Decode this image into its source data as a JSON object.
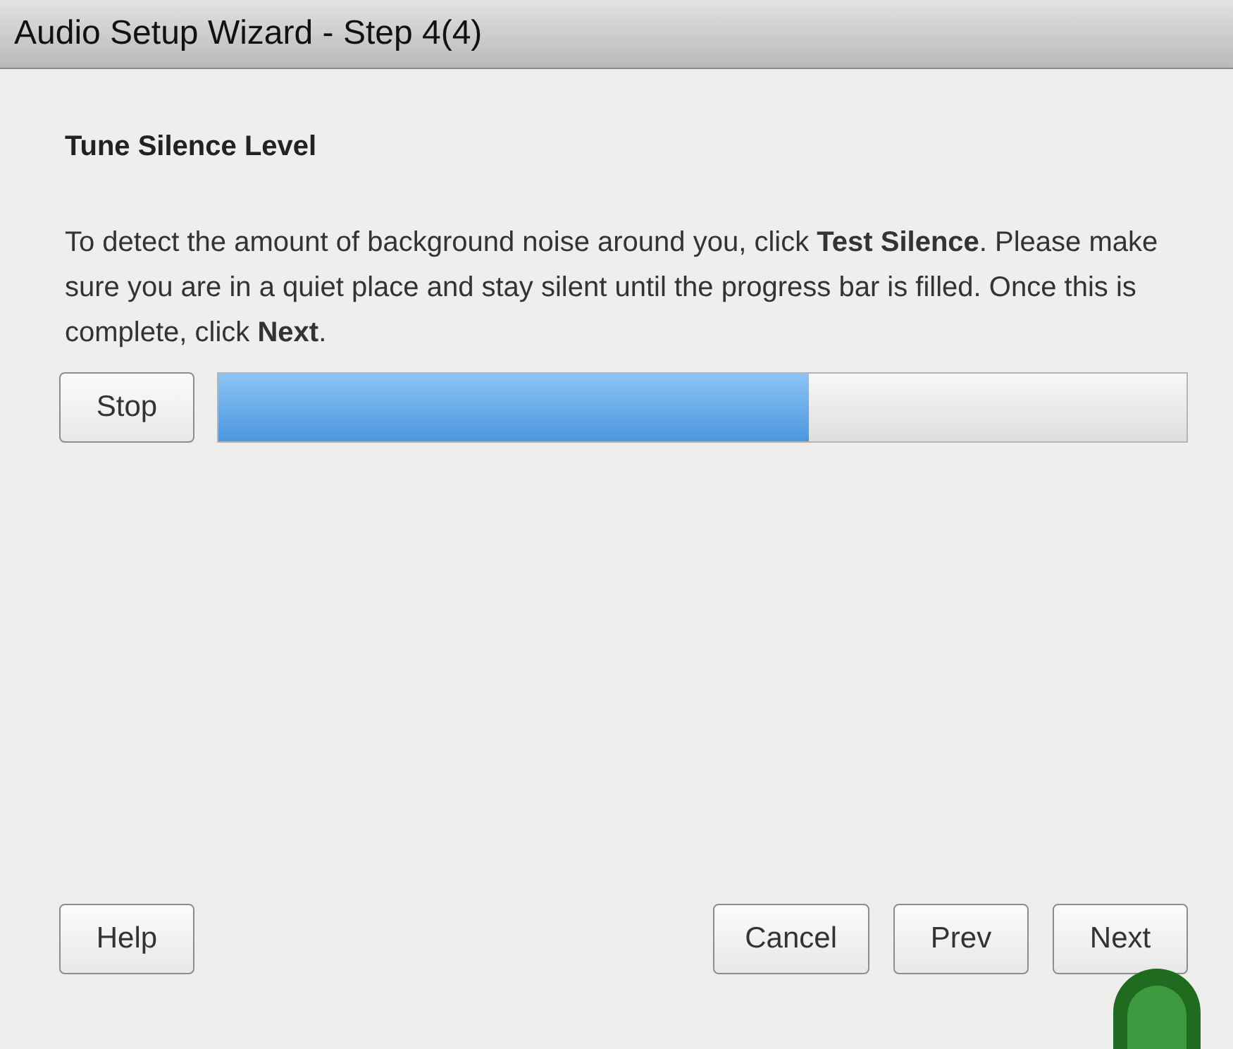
{
  "window": {
    "title": "Audio Setup Wizard - Step 4(4)"
  },
  "heading": "Tune Silence Level",
  "instructions": "To detect the amount of background noise around you, click **Test Silence**. Please make sure you are in a quiet place and stay silent until the progress bar is filled. Once this is complete, click **Next**.",
  "stop_button": "Stop",
  "progress": {
    "level": 0.61
  },
  "left_buttons": [
    "Help"
  ],
  "right_buttons": [
    "Cancel",
    "Prev",
    "Next"
  ]
}
